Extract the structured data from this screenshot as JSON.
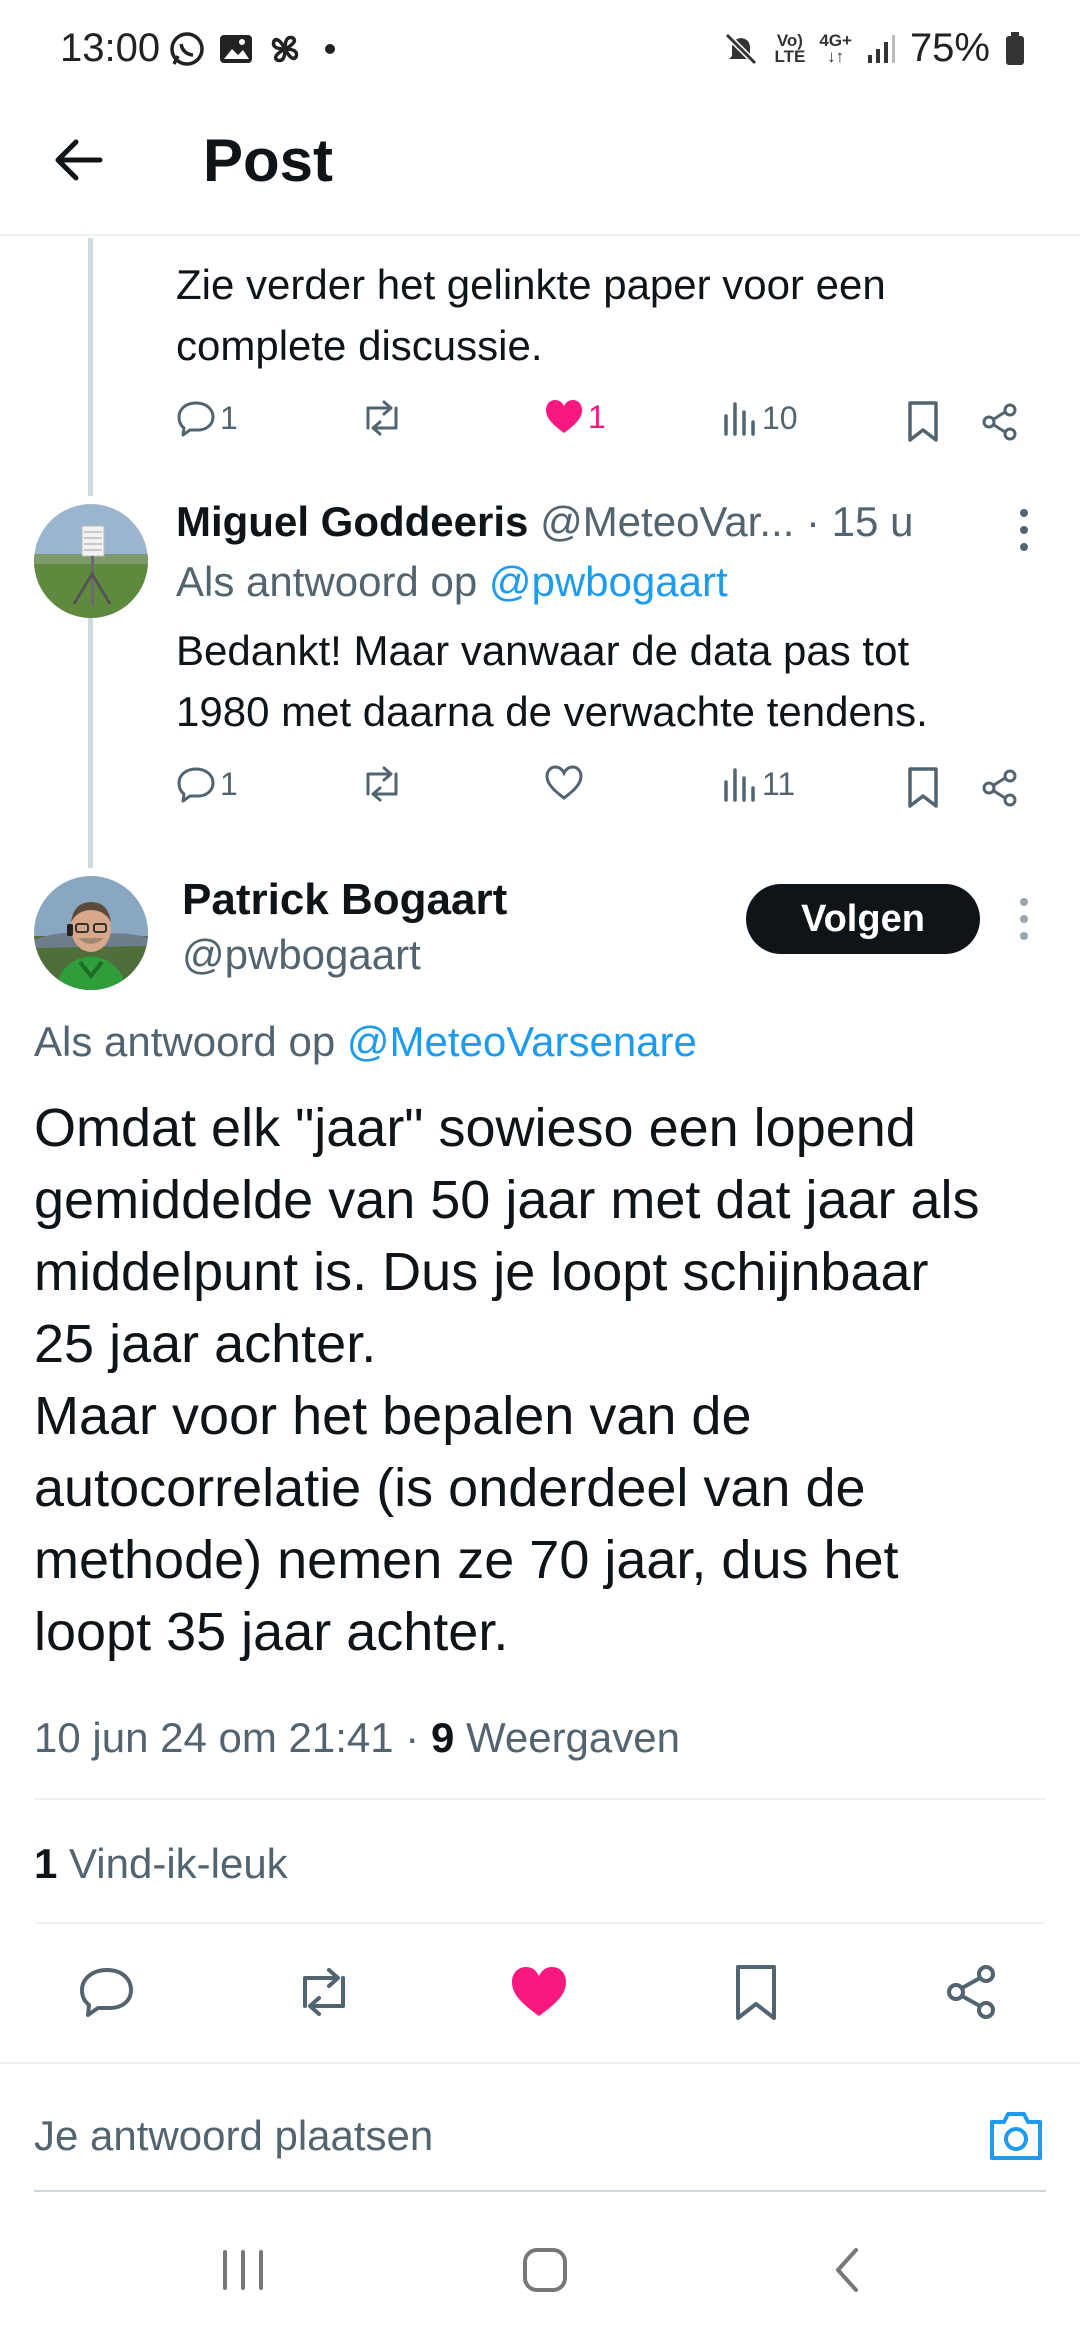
{
  "status_bar": {
    "time": "13:00",
    "battery": "75%",
    "net_top": "Vo)",
    "net_bottom": "LTE",
    "net2_top": "4G+",
    "net2_bottom": "↓↑",
    "icons": [
      "whatsapp-icon",
      "gallery-icon",
      "pinwheel-icon",
      "dot-icon",
      "mute-icon",
      "signal-icon",
      "battery-icon"
    ]
  },
  "app_bar": {
    "title": "Post"
  },
  "prev_tweet": {
    "text_line1": "Zie verder het gelinkte paper voor een",
    "text_line2": "complete discussie.",
    "replies": "1",
    "likes": "1",
    "views": "10"
  },
  "reply_tweet": {
    "name": "Miguel Goddeeris",
    "handle": "@MeteoVar...",
    "time": "· 15 u",
    "reply_prefix": "Als antwoord op",
    "reply_to": "@pwbogaart",
    "text_line1": "Bedankt! Maar vanwaar de data pas tot",
    "text_line2": "1980 met daarna de verwachte tendens.",
    "replies": "1",
    "views": "11"
  },
  "main_tweet": {
    "name": "Patrick Bogaart",
    "handle": "@pwbogaart",
    "follow_label": "Volgen",
    "reply_prefix": "Als antwoord op",
    "reply_to": "@MeteoVarsenare",
    "lines": [
      "Omdat elk \"jaar\" sowieso een lopend",
      "gemiddelde van 50 jaar met dat jaar als",
      "middelpunt is. Dus je loopt schijnbaar",
      "25 jaar achter.",
      "Maar voor het bepalen van de",
      "autocorrelatie (is onderdeel van de",
      "methode) nemen ze 70 jaar, dus het",
      "loopt 35 jaar achter."
    ],
    "timestamp": "10 jun 24 om 21:41 ·",
    "views_count": "9",
    "views_label": "Weergaven",
    "likes_count": "1",
    "likes_label": "Vind-ik-leuk"
  },
  "reply_box": {
    "placeholder": "Je antwoord plaatsen"
  },
  "colors": {
    "accent": "#1d9bf0",
    "like": "#f91880",
    "text": "#0f1419",
    "muted": "#536471"
  }
}
